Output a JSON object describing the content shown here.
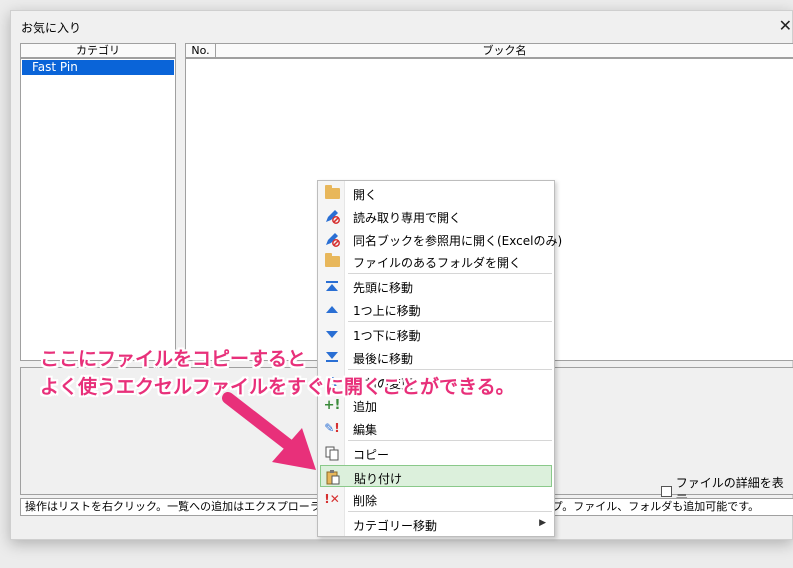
{
  "window": {
    "title": "お気に入り",
    "close_glyph": "✕"
  },
  "category": {
    "header": "カテゴリ",
    "items": [
      "Fast Pin"
    ]
  },
  "books": {
    "col_no": "No.",
    "col_name": "ブック名"
  },
  "detail_toggle": {
    "label": "ファイルの詳細を表示",
    "checked": false
  },
  "status_bar": {
    "text": "操作はリストを右クリック。一覧への追加はエクスプローラからのコピー＆貼り付けか、ドラッグ＆ドロップ。ファイル、フォルダも追加可能です。"
  },
  "context_menu": {
    "items": [
      {
        "label": "開く",
        "icon": "folder-open-icon"
      },
      {
        "label": "読み取り専用で開く",
        "icon": "pencil-prohibited-icon"
      },
      {
        "label": "同名ブックを参照用に開く(Excelのみ)",
        "icon": "pencil-prohibited-icon"
      },
      {
        "label": "ファイルのあるフォルダを開く",
        "icon": "folder-open-icon"
      },
      {
        "label": "先頭に移動",
        "icon": "move-top-icon"
      },
      {
        "label": "1つ上に移動",
        "icon": "move-up-icon"
      },
      {
        "label": "1つ下に移動",
        "icon": "move-down-icon"
      },
      {
        "label": "最後に移動",
        "icon": "move-bottom-icon"
      },
      {
        "label": "名前の変更",
        "icon": "rename-icon"
      },
      {
        "label": "追加",
        "icon": "add-icon"
      },
      {
        "label": "編集",
        "icon": "edit-icon"
      },
      {
        "label": "コピー",
        "icon": "copy-icon"
      },
      {
        "label": "貼り付け",
        "icon": "paste-icon",
        "highlighted": true
      },
      {
        "label": "削除",
        "icon": "delete-icon"
      },
      {
        "label": "カテゴリー移動",
        "icon": "",
        "submenu": true
      }
    ]
  },
  "annotation": {
    "line1": "ここにファイルをコピーすると",
    "line2": "よく使うエクセルファイルをすぐに開くことができる。",
    "color": "#e8307a"
  }
}
